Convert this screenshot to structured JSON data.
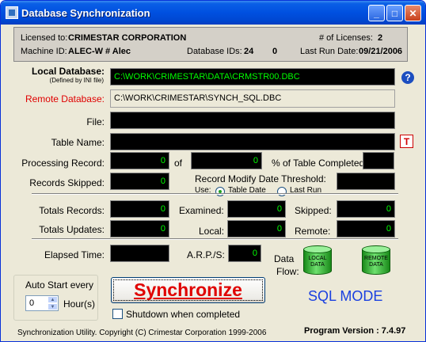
{
  "window": {
    "title": "Database Synchronization"
  },
  "license": {
    "licensed_to_label": "Licensed to:",
    "licensed_to": "CRIMESTAR CORPORATION",
    "licenses_label": "# of Licenses:",
    "licenses": "2",
    "machine_label": "Machine ID:",
    "machine": "ALEC-W # Alec",
    "dbids_label": "Database IDs:",
    "dbid1": "24",
    "dbid2": "0",
    "lastrun_label": "Last Run Date:",
    "lastrun": "09/21/2006"
  },
  "local_db": {
    "label": "Local Database:",
    "sublabel": "(Defined by INI file)",
    "value": "C:\\WORK\\CRIMESTAR\\DATA\\CRMSTR00.DBC"
  },
  "remote_db": {
    "label": "Remote Database:",
    "value": "C:\\WORK\\CRIMESTAR\\SYNCH_SQL.DBC"
  },
  "file": {
    "label": "File:",
    "value": ""
  },
  "table_name": {
    "label": "Table Name:",
    "value": ""
  },
  "processing": {
    "label": "Processing Record:",
    "value": "0",
    "of_label": "of",
    "total": "0",
    "pct_label": "% of Table Completed:",
    "pct": ""
  },
  "skipped": {
    "label": "Records Skipped:",
    "value": "0"
  },
  "threshold": {
    "label": "Record Modify Date Threshold:",
    "use_label": "Use:",
    "option_table": "Table Date",
    "option_last": "Last Run",
    "selected": "Table Date",
    "value": ""
  },
  "totals": {
    "records_label": "Totals Records:",
    "records": "0",
    "examined_label": "Examined:",
    "examined": "0",
    "skipped_label": "Skipped:",
    "skipped": "0",
    "updates_label": "Totals Updates:",
    "updates": "0",
    "local_label": "Local:",
    "local": "0",
    "remote_label": "Remote:",
    "remote": "0"
  },
  "elapsed": {
    "label": "Elapsed Time:",
    "value": ""
  },
  "arps": {
    "label": "A.R.P./S:",
    "value": "0"
  },
  "dataflow": {
    "label1": "Data",
    "label2": "Flow:",
    "local1": "LOCAL",
    "local2": "DATA",
    "remote1": "REMOTE",
    "remote2": "DATA"
  },
  "mode": {
    "text": "SQL MODE",
    "color": "#1a40e0"
  },
  "autostart": {
    "label": "Auto Start every",
    "value": "0",
    "unit": "Hour(s)"
  },
  "sync_button": {
    "label": "Synchronize"
  },
  "shutdown": {
    "label": "Shutdown when completed",
    "checked": false
  },
  "footer": {
    "copyright": "Synchronization Utility. Copyright (C) Crimestar Corporation 1999-2006",
    "version": "Program Version : 7.4.97"
  },
  "icons": {
    "help": "?",
    "table": "T",
    "minimize": "_",
    "maximize": "□",
    "close": "✕"
  }
}
